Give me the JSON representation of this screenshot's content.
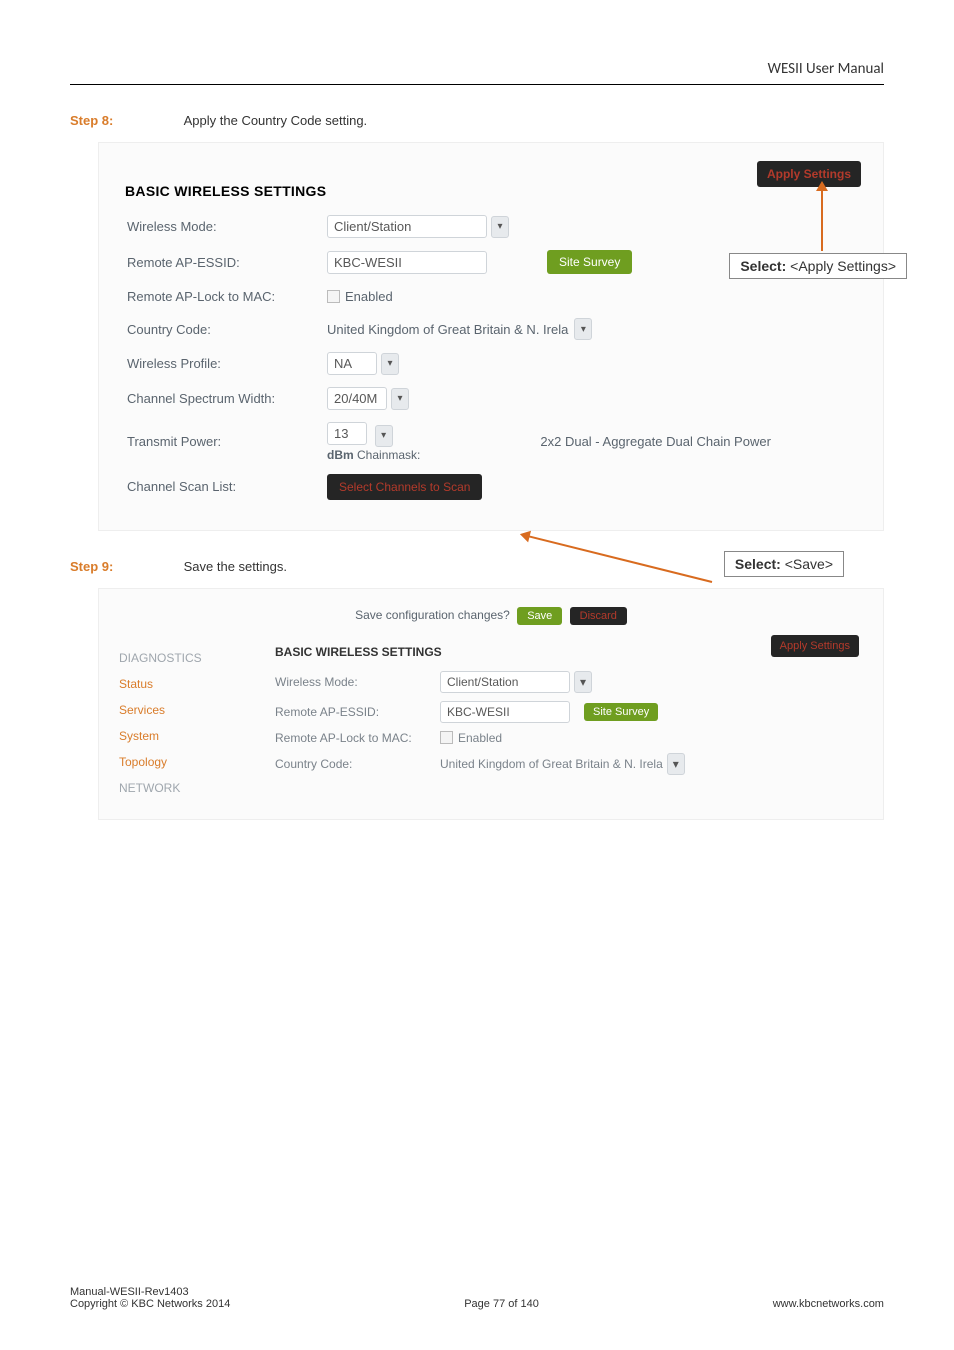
{
  "header": {
    "title": "WESII User Manual"
  },
  "step8": {
    "label": "Step 8:",
    "text": "Apply the Country Code setting."
  },
  "step9": {
    "label": "Step 9:",
    "text": "Save the settings."
  },
  "callout1": {
    "prefix": "Select:",
    "value": "<Apply Settings>"
  },
  "callout2": {
    "prefix": "Select:",
    "value": "<Save>"
  },
  "panel1": {
    "apply_btn": "Apply Settings",
    "section_title": "BASIC WIRELESS SETTINGS",
    "rows": {
      "wireless_mode": {
        "label": "Wireless Mode:",
        "value": "Client/Station"
      },
      "remote_ap_essid": {
        "label": "Remote AP-ESSID:",
        "value": "KBC-WESII",
        "survey_btn": "Site Survey"
      },
      "remote_ap_lock": {
        "label": "Remote AP-Lock to MAC:",
        "value": "Enabled"
      },
      "country_code": {
        "label": "Country Code:",
        "value": "United Kingdom of Great Britain & N. Irela"
      },
      "wireless_profile": {
        "label": "Wireless Profile:",
        "value": "NA"
      },
      "channel_spectrum": {
        "label": "Channel Spectrum Width:",
        "value": "20/40M"
      },
      "transmit_power": {
        "label": "Transmit Power:",
        "value": "13",
        "unit_label": "dBm",
        "chainmask_label": "Chainmask:",
        "chain_text": "2x2 Dual - Aggregate Dual Chain Power"
      },
      "channel_scan_list": {
        "label": "Channel Scan List:",
        "button": "Select Channels to Scan"
      }
    }
  },
  "panel2": {
    "save_prompt": "Save configuration changes?",
    "save_btn": "Save",
    "discard_btn": "Discard",
    "apply_btn": "Apply Settings",
    "sidebar": {
      "diagnostics": "DIAGNOSTICS",
      "status": "Status",
      "services": "Services",
      "system": "System",
      "topology": "Topology",
      "network": "NETWORK"
    },
    "section_title": "BASIC WIRELESS SETTINGS",
    "rows": {
      "wireless_mode": {
        "label": "Wireless Mode:",
        "value": "Client/Station"
      },
      "remote_ap_essid": {
        "label": "Remote AP-ESSID:",
        "value": "KBC-WESII",
        "survey_btn": "Site Survey"
      },
      "remote_ap_lock": {
        "label": "Remote AP-Lock to MAC:",
        "value": "Enabled"
      },
      "country_code": {
        "label": "Country Code:",
        "value": "United Kingdom of Great Britain & N. Irela"
      }
    }
  },
  "footer": {
    "left_line1": "Manual-WESII-Rev1403",
    "left_line2": "Copyright © KBC Networks 2014",
    "center": "Page 77 of 140",
    "right": "www.kbcnetworks.com"
  }
}
